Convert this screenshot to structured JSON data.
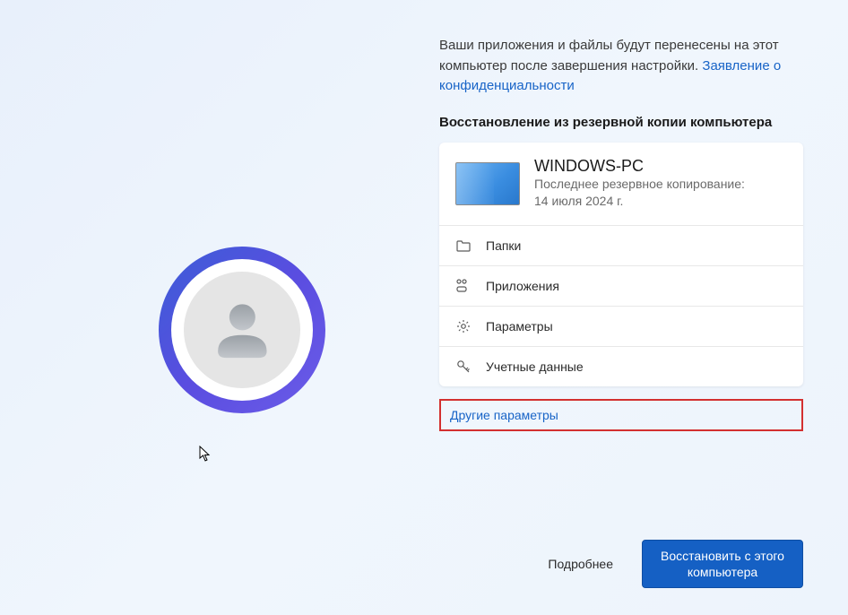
{
  "intro": {
    "text": "Ваши приложения и файлы будут перенесены на этот компьютер после завершения настройки.",
    "privacy_link": "Заявление о конфиденциальности"
  },
  "section_title": "Восстановление из резервной копии компьютера",
  "backup": {
    "pc_name": "WINDOWS-PC",
    "last_backup_label": "Последнее резервное копирование:",
    "last_backup_date": "14 июля 2024 г.",
    "rows": {
      "folders": "Папки",
      "apps": "Приложения",
      "settings": "Параметры",
      "credentials": "Учетные данные"
    }
  },
  "more_options": "Другие параметры",
  "footer": {
    "details": "Подробнее",
    "restore": "Восстановить с этого компьютера"
  }
}
